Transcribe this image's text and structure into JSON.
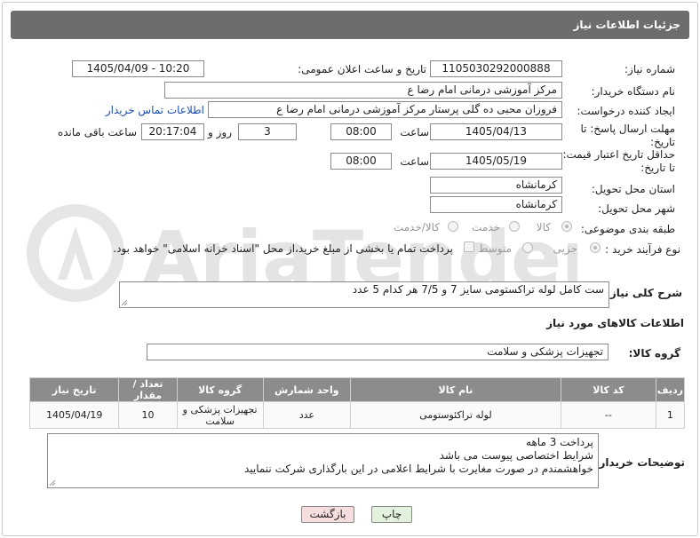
{
  "header": {
    "title": "جزئیات اطلاعات نیاز"
  },
  "fields": {
    "need_number_label": "شماره نیاز:",
    "need_number": "1105030292000888",
    "announce_label": "تاریخ و ساعت اعلان عمومی:",
    "announce_value": "1405/04/09 - 10:20",
    "buyer_org_label": "نام دستگاه خریدار:",
    "buyer_org": "مرکز آموزشی  درمانی امام رضا  ع",
    "creator_label": "ایجاد کننده درخواست:",
    "creator": "فروزان محبی ده گلی پرستار مرکز آموزشی  درمانی امام رضا  ع",
    "contact_link": "اطلاعات تماس خریدار",
    "deadline_label": "مهلت ارسال پاسخ: تا تاریخ:",
    "deadline_date": "1405/04/13",
    "time_label": "ساعت",
    "deadline_time": "08:00",
    "days_value": "3",
    "days_label": "روز و",
    "remaining_time": "20:17:04",
    "remaining_label": "ساعت باقی مانده",
    "validity_label": "حداقل تاریخ اعتبار قیمت: تا تاریخ:",
    "validity_date": "1405/05/19",
    "validity_time": "08:00",
    "province_label": "استان محل تحویل:",
    "province": "کرمانشاه",
    "city_label": "شهر محل تحویل:",
    "city": "کرمانشاه",
    "category_label": "طبقه بندی موضوعی:",
    "category_options": [
      "کالا",
      "خدمت",
      "کالا/خدمت"
    ],
    "process_label": "نوع فرآیند خرید :",
    "process_options": [
      "جزیی",
      "متوسط"
    ],
    "payment_note": "پرداخت تمام یا بخشی از مبلغ خرید،از محل \"اسناد خزانه اسلامی\" خواهد بود."
  },
  "summary": {
    "label": "شرح کلی نیاز:",
    "text": "ست کامل لوله تراکستومی   سایز 7 و 7/5    هر کدام 5 عدد"
  },
  "goods": {
    "section_title": "اطلاعات کالاهای مورد نیاز",
    "group_label": "گروه کالا:",
    "group_value": "تجهیزات پزشکی و سلامت",
    "columns": [
      "ردیف",
      "کد کالا",
      "نام کالا",
      "واحد شمارش",
      "گروه کالا",
      "تعداد / مقدار",
      "تاریخ نیاز"
    ],
    "rows": [
      {
        "index": "1",
        "code": "--",
        "name": "لوله تراکئوستومی",
        "unit": "عدد",
        "group": "تجهیزات پزشکی و سلامت",
        "qty": "10",
        "date": "1405/04/19"
      }
    ]
  },
  "buyer_notes": {
    "label": "توضیحات خریدار:",
    "lines": [
      "پرداخت 3 ماهه",
      "شرایط اختصاصی پیوست می باشد",
      "خواهشمندم  در صورت مغایرت با شرایط اعلامی در این بارگذاری شرکت ننمایید"
    ]
  },
  "buttons": {
    "print": "چاپ",
    "back": "بازگشت"
  },
  "watermark": {
    "text": "AriaTender.net"
  },
  "colors": {
    "titlebar": "#6d6d6d",
    "table_header": "#8c8c8c",
    "back_button": "#f6dede",
    "print_button": "#e3f2dc"
  }
}
